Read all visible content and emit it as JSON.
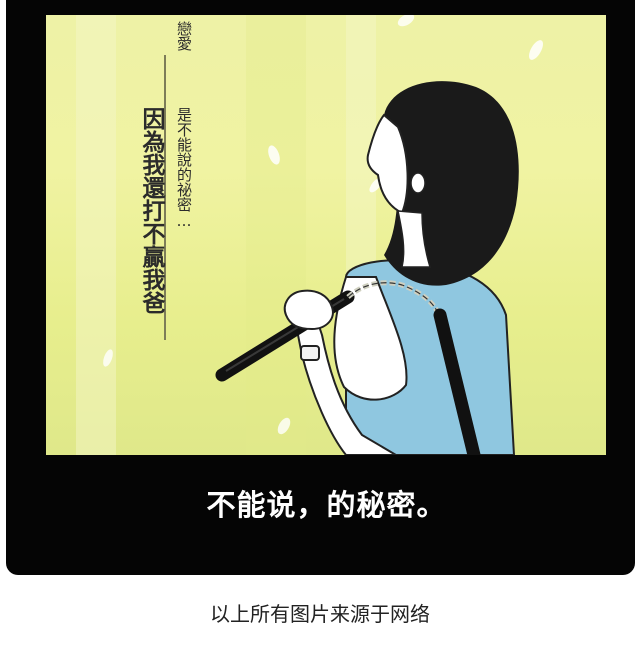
{
  "comic": {
    "vertical_small_1": "戀愛",
    "vertical_small_2": "是不能說的祕密…",
    "vertical_large": "因為我還打不贏我爸"
  },
  "caption": "不能说，的秘密。",
  "source_note": "以上所有图片来源于网络",
  "colors": {
    "frame": "#050505",
    "panel_bg": "#eef2a6",
    "shirt": "#8fc7e0",
    "hair": "#1a1a1a"
  }
}
